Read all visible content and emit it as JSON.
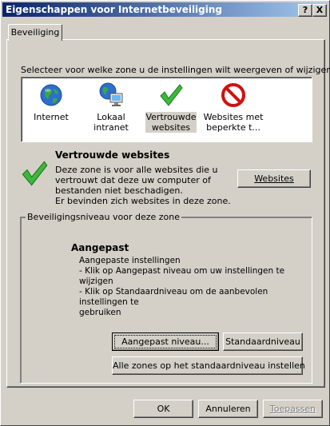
{
  "window": {
    "title": "Eigenschappen voor Internetbeveiliging",
    "help_button": "?",
    "close_button": "X"
  },
  "tabs": [
    {
      "label": "Beveiliging"
    }
  ],
  "zone_prompt": "Selecteer voor welke zone u de instellingen wilt weergeven of wijzigen.",
  "zones": [
    {
      "label_line1": "Internet",
      "label_line2": "",
      "icon": "globe-icon"
    },
    {
      "label_line1": "Lokaal intranet",
      "label_line2": "",
      "icon": "intranet-globe-monitor-icon"
    },
    {
      "label_line1": "Vertrouwde",
      "label_line2": "websites",
      "icon": "checkmark-icon",
      "selected": true
    },
    {
      "label_line1": "Websites met",
      "label_line2": "beperkte t...",
      "icon": "no-entry-icon"
    }
  ],
  "selected_zone": {
    "title": "Vertrouwde websites",
    "desc_lines": [
      "Deze zone is voor alle websites die u",
      "vertrouwt dat deze uw computer of",
      "bestanden niet beschadigen.",
      "Er bevinden zich websites in deze zone."
    ],
    "websites_button": "Websites"
  },
  "security_level": {
    "group_label": "Beveiligingsniveau voor deze zone",
    "level_title": "Aangepast",
    "lines": [
      "Aangepaste instellingen",
      "- Klik op Aangepast niveau om uw instellingen te wijzigen",
      "- Klik op Standaardniveau om de aanbevolen instellingen te",
      "gebruiken"
    ],
    "custom_level_button": "Aangepast niveau...",
    "default_level_button": "Standaardniveau"
  },
  "all_zones_button": "Alle zones op het standaardniveau instellen",
  "footer": {
    "ok": "OK",
    "cancel": "Annuleren",
    "apply": "Toepassen"
  }
}
